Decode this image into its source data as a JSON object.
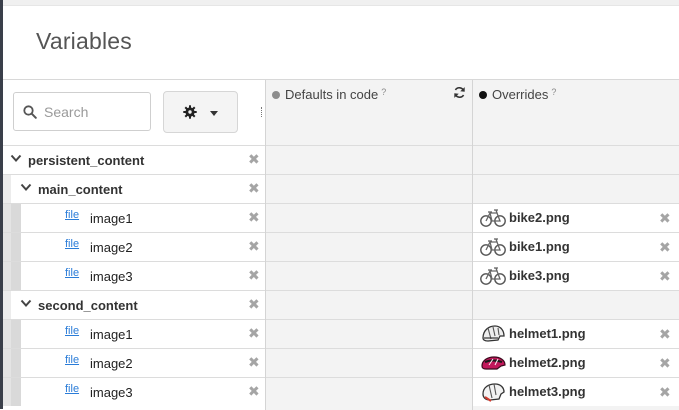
{
  "page": {
    "title": "Variables"
  },
  "toolbar": {
    "search_placeholder": "Search"
  },
  "columns": {
    "defaults": {
      "label": "Defaults in code",
      "help": "?"
    },
    "overrides": {
      "label": "Overrides",
      "help": "?"
    }
  },
  "colors": {
    "defaults_dot": "#8d8d8d",
    "overrides_dot": "#111111",
    "link": "#2a7cd8",
    "sidebar_dark": "#3a3f4a"
  },
  "rows": [
    {
      "type": "group",
      "level": 0,
      "name": "persistent_content"
    },
    {
      "type": "group",
      "level": 1,
      "name": "main_content"
    },
    {
      "type": "item",
      "kind": "file",
      "name": "image1",
      "override": "bike2.png",
      "icon": "bike-icon"
    },
    {
      "type": "item",
      "kind": "file",
      "name": "image2",
      "override": "bike1.png",
      "icon": "bike-icon"
    },
    {
      "type": "item",
      "kind": "file",
      "name": "image3",
      "override": "bike3.png",
      "icon": "bike-icon"
    },
    {
      "type": "group",
      "level": 1,
      "name": "second_content"
    },
    {
      "type": "item",
      "kind": "file",
      "name": "image1",
      "override": "helmet1.png",
      "icon": "helmet-white-icon"
    },
    {
      "type": "item",
      "kind": "file",
      "name": "image2",
      "override": "helmet2.png",
      "icon": "helmet-pink-icon"
    },
    {
      "type": "item",
      "kind": "file",
      "name": "image3",
      "override": "helmet3.png",
      "icon": "helmet-white-icon"
    }
  ]
}
